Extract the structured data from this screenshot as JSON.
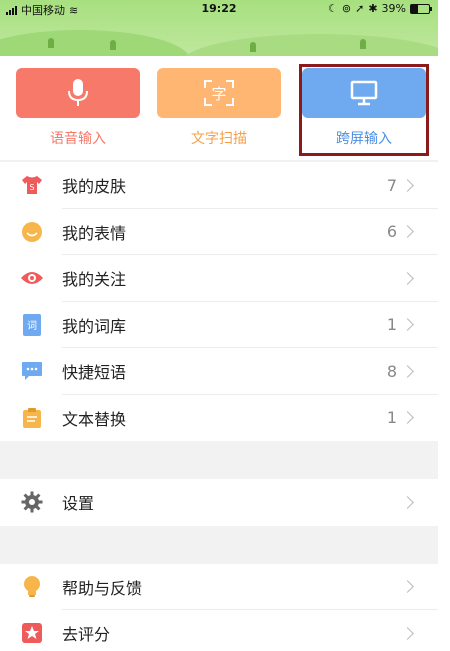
{
  "status_bar": {
    "carrier": "中国移动",
    "time": "19:22",
    "battery": "39%"
  },
  "tools": [
    {
      "label": "语音输入",
      "color": "#f6796a",
      "label_color": "#f6796a",
      "icon": "microphone-icon"
    },
    {
      "label": "文字扫描",
      "color": "#ffb673",
      "label_color": "#f5a14a",
      "icon": "text-scan-icon",
      "glyph": "字"
    },
    {
      "label": "跨屏输入",
      "color": "#6fa9ef",
      "label_color": "#4b8fe3",
      "icon": "monitor-icon"
    }
  ],
  "list_group1": [
    {
      "label": "我的皮肤",
      "count": "7",
      "icon": "skin-tshirt-icon"
    },
    {
      "label": "我的表情",
      "count": "6",
      "icon": "emoji-face-icon"
    },
    {
      "label": "我的关注",
      "count": "",
      "icon": "eye-icon"
    },
    {
      "label": "我的词库",
      "count": "1",
      "icon": "dictionary-icon",
      "glyph": "词"
    },
    {
      "label": "快捷短语",
      "count": "8",
      "icon": "chat-bubble-icon"
    },
    {
      "label": "文本替换",
      "count": "1",
      "icon": "clipboard-icon"
    }
  ],
  "list_group2": [
    {
      "label": "设置",
      "icon": "gear-icon"
    }
  ],
  "list_group3": [
    {
      "label": "帮助与反馈",
      "icon": "lightbulb-icon"
    },
    {
      "label": "去评分",
      "icon": "star-icon"
    }
  ]
}
